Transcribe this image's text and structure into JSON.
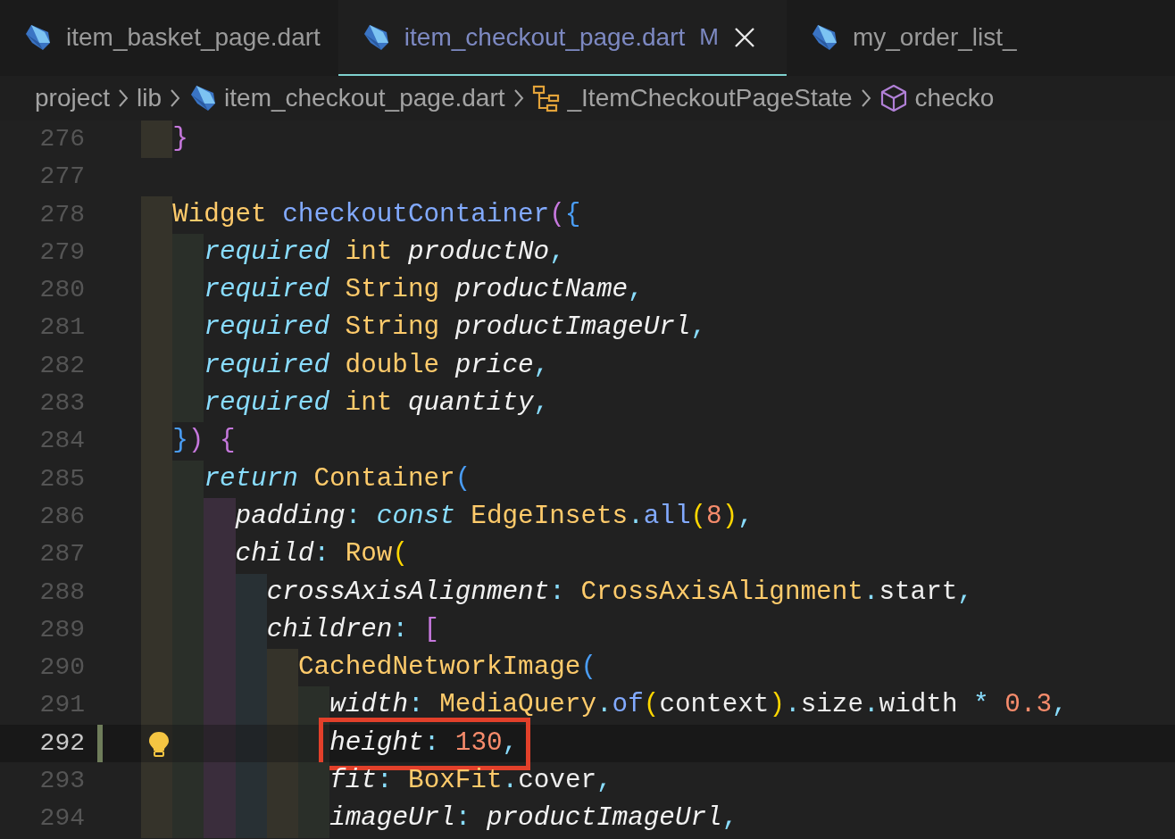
{
  "tabs": [
    {
      "label": "item_basket_page.dart",
      "selected": false
    },
    {
      "label": "item_checkout_page.dart",
      "selected": true,
      "badge": "M"
    },
    {
      "label": "my_order_list_",
      "selected": false
    }
  ],
  "breadcrumbs": [
    {
      "kind": "folder",
      "text": "project"
    },
    {
      "kind": "folder",
      "text": "lib"
    },
    {
      "kind": "file",
      "text": "item_checkout_page.dart"
    },
    {
      "kind": "class",
      "text": "_ItemCheckoutPageState"
    },
    {
      "kind": "method",
      "text": "checko"
    }
  ],
  "editor": {
    "lines": [
      {
        "number": "276",
        "current": false,
        "modified": false,
        "boxed": false,
        "tokens": [
          {
            "kind": "bracket1",
            "text": "}"
          }
        ]
      },
      {
        "number": "277",
        "current": false,
        "modified": false,
        "boxed": false
      },
      {
        "number": "278",
        "current": false,
        "modified": false,
        "boxed": false,
        "tokens": [
          {
            "kind": "type",
            "text": "Widget "
          },
          {
            "kind": "func",
            "text": "checkoutContainer"
          },
          {
            "kind": "bracket1",
            "text": "("
          },
          {
            "kind": "bracket2",
            "text": "{"
          }
        ],
        "children": [
          {
            "number": "279",
            "current": false,
            "modified": false,
            "boxed": false,
            "tokens": [
              {
                "kind": "keyword",
                "text": "required "
              },
              {
                "kind": "type",
                "text": "int "
              },
              {
                "kind": "param",
                "text": "productNo"
              },
              {
                "kind": "punct",
                "text": ","
              }
            ]
          },
          {
            "number": "280",
            "current": false,
            "modified": false,
            "boxed": false,
            "tokens": [
              {
                "kind": "keyword",
                "text": "required "
              },
              {
                "kind": "type",
                "text": "String "
              },
              {
                "kind": "param",
                "text": "productName"
              },
              {
                "kind": "punct",
                "text": ","
              }
            ]
          },
          {
            "number": "281",
            "current": false,
            "modified": false,
            "boxed": false,
            "tokens": [
              {
                "kind": "keyword",
                "text": "required "
              },
              {
                "kind": "type",
                "text": "String "
              },
              {
                "kind": "param",
                "text": "productImageUrl"
              },
              {
                "kind": "punct",
                "text": ","
              }
            ]
          },
          {
            "number": "282",
            "current": false,
            "modified": false,
            "boxed": false,
            "tokens": [
              {
                "kind": "keyword",
                "text": "required "
              },
              {
                "kind": "type",
                "text": "double "
              },
              {
                "kind": "param",
                "text": "price"
              },
              {
                "kind": "punct",
                "text": ","
              }
            ]
          },
          {
            "number": "283",
            "current": false,
            "modified": false,
            "boxed": false,
            "tokens": [
              {
                "kind": "keyword",
                "text": "required "
              },
              {
                "kind": "type",
                "text": "int "
              },
              {
                "kind": "param",
                "text": "quantity"
              },
              {
                "kind": "punct",
                "text": ","
              }
            ]
          }
        ]
      },
      {
        "number": "284",
        "current": false,
        "modified": false,
        "boxed": false,
        "tokens": [
          {
            "kind": "bracket2",
            "text": "}"
          },
          {
            "kind": "bracket1",
            "text": ")"
          },
          {
            "kind": "bracket1",
            "text": " {"
          }
        ],
        "children": [
          {
            "number": "285",
            "current": false,
            "modified": false,
            "boxed": false,
            "tokens": [
              {
                "kind": "keyword",
                "text": "return "
              },
              {
                "kind": "type",
                "text": "Container"
              },
              {
                "kind": "bracket2",
                "text": "("
              }
            ],
            "children": [
              {
                "number": "286",
                "current": false,
                "modified": false,
                "boxed": false,
                "tokens": [
                  {
                    "kind": "param",
                    "text": "padding"
                  },
                  {
                    "kind": "punct",
                    "text": ": "
                  },
                  {
                    "kind": "keyword",
                    "text": "const "
                  },
                  {
                    "kind": "type",
                    "text": "EdgeInsets"
                  },
                  {
                    "kind": "punct",
                    "text": "."
                  },
                  {
                    "kind": "func",
                    "text": "all"
                  },
                  {
                    "kind": "bracket3",
                    "text": "("
                  },
                  {
                    "kind": "number",
                    "text": "8"
                  },
                  {
                    "kind": "bracket3",
                    "text": ")"
                  },
                  {
                    "kind": "punct",
                    "text": ","
                  }
                ]
              },
              {
                "number": "287",
                "current": false,
                "modified": false,
                "boxed": false,
                "tokens": [
                  {
                    "kind": "param",
                    "text": "child"
                  },
                  {
                    "kind": "punct",
                    "text": ": "
                  },
                  {
                    "kind": "type",
                    "text": "Row"
                  },
                  {
                    "kind": "bracket3",
                    "text": "("
                  }
                ],
                "children": [
                  {
                    "number": "288",
                    "current": false,
                    "modified": false,
                    "boxed": false,
                    "tokens": [
                      {
                        "kind": "param",
                        "text": "crossAxisAlignment"
                      },
                      {
                        "kind": "punct",
                        "text": ": "
                      },
                      {
                        "kind": "type",
                        "text": "CrossAxisAlignment"
                      },
                      {
                        "kind": "punct",
                        "text": "."
                      },
                      {
                        "kind": "plain",
                        "text": "start"
                      },
                      {
                        "kind": "punct",
                        "text": ","
                      }
                    ]
                  },
                  {
                    "number": "289",
                    "current": false,
                    "modified": false,
                    "boxed": false,
                    "tokens": [
                      {
                        "kind": "param",
                        "text": "children"
                      },
                      {
                        "kind": "punct",
                        "text": ": "
                      },
                      {
                        "kind": "bracket1",
                        "text": "["
                      }
                    ],
                    "children": [
                      {
                        "number": "290",
                        "current": false,
                        "modified": false,
                        "boxed": false,
                        "tokens": [
                          {
                            "kind": "type",
                            "text": "CachedNetworkImage"
                          },
                          {
                            "kind": "bracket2",
                            "text": "("
                          }
                        ],
                        "children": [
                          {
                            "number": "291",
                            "current": false,
                            "modified": false,
                            "boxed": false,
                            "tokens": [
                              {
                                "kind": "param",
                                "text": "width"
                              },
                              {
                                "kind": "punct",
                                "text": ": "
                              },
                              {
                                "kind": "type",
                                "text": "MediaQuery"
                              },
                              {
                                "kind": "punct",
                                "text": "."
                              },
                              {
                                "kind": "func",
                                "text": "of"
                              },
                              {
                                "kind": "bracket3",
                                "text": "("
                              },
                              {
                                "kind": "plain",
                                "text": "context"
                              },
                              {
                                "kind": "bracket3",
                                "text": ")"
                              },
                              {
                                "kind": "punct",
                                "text": "."
                              },
                              {
                                "kind": "plain",
                                "text": "size"
                              },
                              {
                                "kind": "punct",
                                "text": "."
                              },
                              {
                                "kind": "plain",
                                "text": "width "
                              },
                              {
                                "kind": "punct",
                                "text": "* "
                              },
                              {
                                "kind": "number",
                                "text": "0.3"
                              },
                              {
                                "kind": "punct",
                                "text": ","
                              }
                            ]
                          },
                          {
                            "number": "292",
                            "current": true,
                            "modified": true,
                            "boxed": true,
                            "tokens": [
                              {
                                "kind": "param",
                                "text": "height"
                              },
                              {
                                "kind": "punct",
                                "text": ": "
                              },
                              {
                                "kind": "number",
                                "text": "130"
                              },
                              {
                                "kind": "punct",
                                "text": ","
                              }
                            ]
                          },
                          {
                            "number": "293",
                            "current": false,
                            "modified": false,
                            "boxed": false,
                            "tokens": [
                              {
                                "kind": "param",
                                "text": "fit"
                              },
                              {
                                "kind": "punct",
                                "text": ": "
                              },
                              {
                                "kind": "type",
                                "text": "BoxFit"
                              },
                              {
                                "kind": "punct",
                                "text": "."
                              },
                              {
                                "kind": "plain",
                                "text": "cover"
                              },
                              {
                                "kind": "punct",
                                "text": ","
                              }
                            ]
                          },
                          {
                            "number": "294",
                            "current": false,
                            "modified": false,
                            "boxed": false,
                            "tokens": [
                              {
                                "kind": "param",
                                "text": "imageUrl"
                              },
                              {
                                "kind": "punct",
                                "text": ": "
                              },
                              {
                                "kind": "param",
                                "text": "productImageUrl"
                              },
                              {
                                "kind": "punct",
                                "text": ","
                              }
                            ]
                          }
                        ]
                      }
                    ]
                  }
                ]
              }
            ]
          }
        ]
      }
    ]
  }
}
